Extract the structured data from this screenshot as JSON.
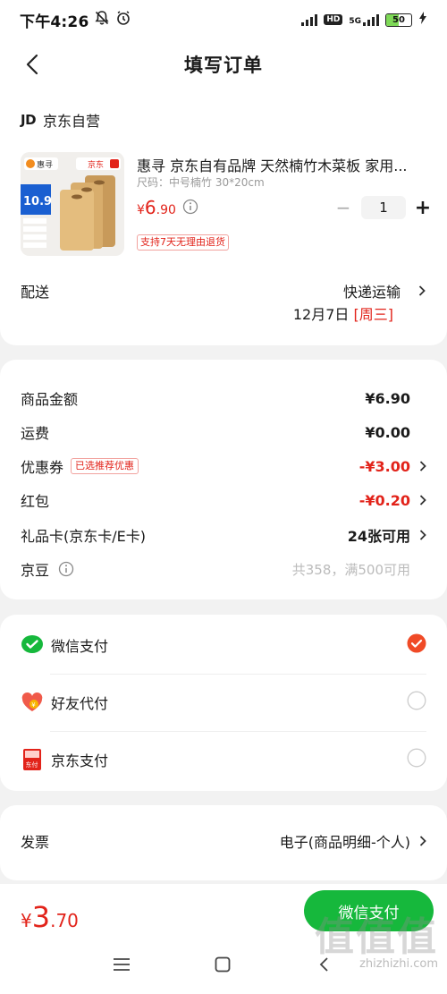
{
  "status_bar": {
    "time": "下午4:26",
    "network": "5G",
    "hd": "HD",
    "battery": "50",
    "battery_level": 0.5
  },
  "nav": {
    "title": "填写订单"
  },
  "store": {
    "logo": "JD",
    "name": "京东自营"
  },
  "product": {
    "name": "惠寻 京东自有品牌 天然楠竹木菜板 家用...",
    "spec": "尺码：中号楠竹 30*20cm",
    "price_currency": "¥",
    "price_int": "6",
    "price_dec": ".90",
    "quantity": "1",
    "tag": "支持7天无理由退货",
    "image_labels": {
      "brand1": "惠寻",
      "brand2": "京东",
      "promo_price": "10.9"
    }
  },
  "delivery": {
    "label": "配送",
    "method": "快递运输",
    "date": "12月7日",
    "weekday": "[周三]"
  },
  "summary": {
    "rows": [
      {
        "label": "商品金额",
        "value": "¥6.90"
      },
      {
        "label": "运费",
        "value": "¥0.00"
      },
      {
        "label": "优惠券",
        "badge": "已选推荐优惠",
        "value": "-¥3.00"
      },
      {
        "label": "红包",
        "value": "-¥0.20"
      },
      {
        "label": "礼品卡(京东卡/E卡)",
        "value": "24张可用"
      },
      {
        "label": "京豆",
        "value": "共358，满500可用"
      }
    ]
  },
  "payment": {
    "options": [
      {
        "label": "微信支付",
        "icon": "wechat-pay-icon",
        "selected": true
      },
      {
        "label": "好友代付",
        "icon": "friend-pay-icon",
        "selected": false
      },
      {
        "label": "京东支付",
        "icon": "jd-pay-icon",
        "selected": false
      }
    ],
    "jd_pay_icon_text": "东付"
  },
  "invoice": {
    "label": "发票",
    "value": "电子(商品明细-个人)"
  },
  "bottom": {
    "total_currency": "¥",
    "total_int": "3",
    "total_dec": ".70",
    "pay_button": "微信支付"
  },
  "watermark": {
    "big": "值值值",
    "small": "zhizhizhi.com"
  },
  "colors": {
    "accent_red": "#e2231a",
    "wechat_green": "#16b83c",
    "selected_radio": "#f04a26"
  }
}
